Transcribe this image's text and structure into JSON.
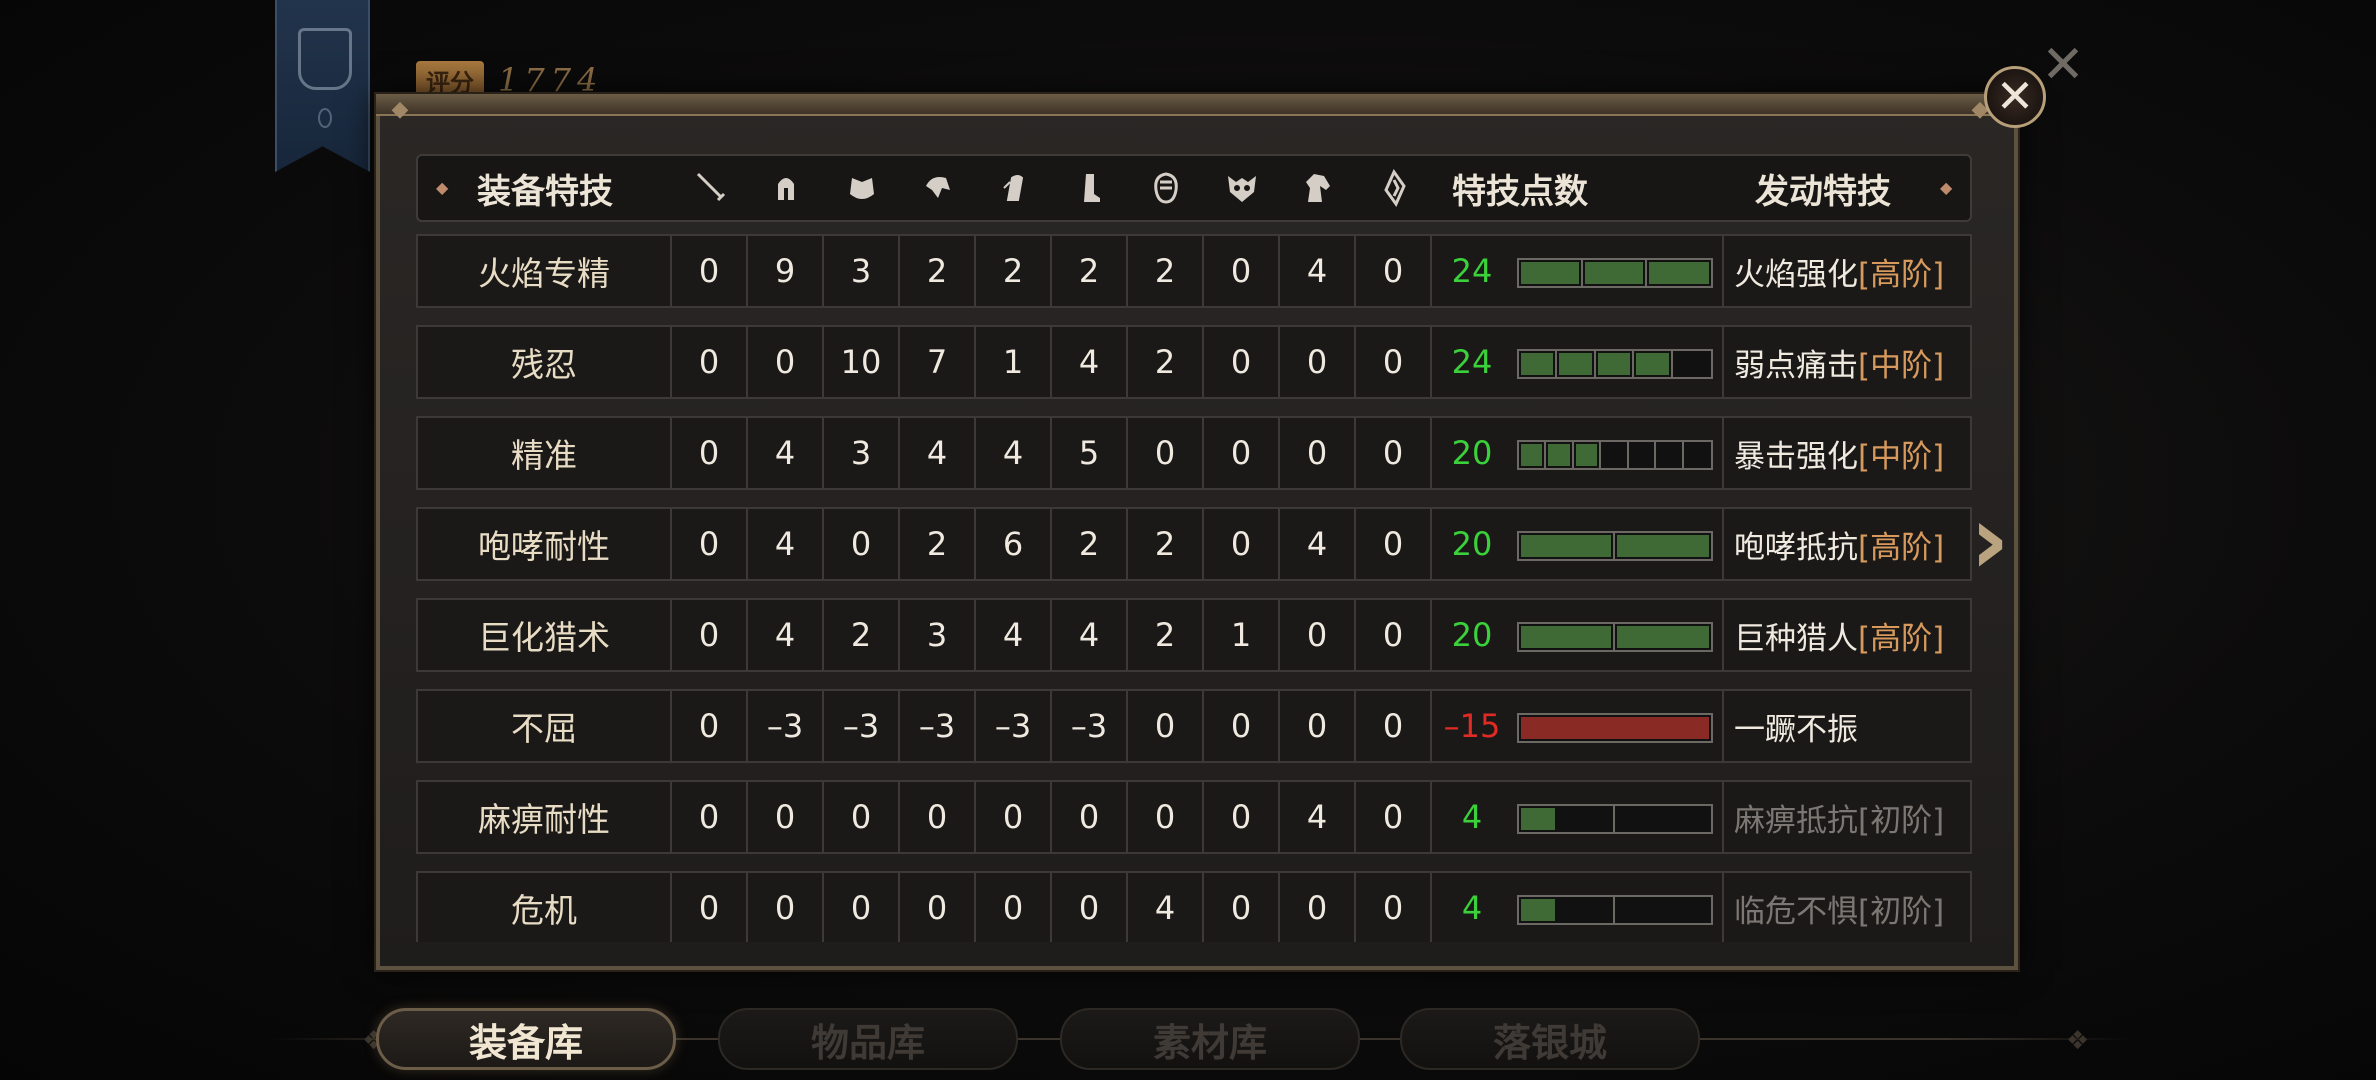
{
  "background": {
    "score_label": "评分",
    "score_value": "1774"
  },
  "header": {
    "title": "装备特技",
    "slot_icons": [
      "sword-icon",
      "helmet-icon",
      "chest-armor-icon",
      "arm-armor-icon",
      "waist-armor-icon",
      "leg-armor-icon",
      "charm-icon",
      "monster-mask-icon",
      "pet-icon",
      "wing-icon"
    ],
    "points_label": "特技点数",
    "active_label": "发动特技"
  },
  "colors": {
    "positive": "#3ad13a",
    "negative": "#e02a24",
    "tier": "#d79a5c",
    "bar_fill": "#3f6a36",
    "bar_negative": "#8a2a24"
  },
  "rows": [
    {
      "name": "火焰专精",
      "values": [
        "0",
        "9",
        "3",
        "2",
        "2",
        "2",
        "2",
        "0",
        "4",
        "0"
      ],
      "points": "24",
      "segments": 3,
      "fill_ratio": 1.0,
      "skill": "火焰强化",
      "tier": "[高阶]",
      "dim": false,
      "negative": false
    },
    {
      "name": "残忍",
      "values": [
        "0",
        "0",
        "10",
        "7",
        "1",
        "4",
        "2",
        "0",
        "0",
        "0"
      ],
      "points": "24",
      "segments": 5,
      "fill_ratio": 0.8,
      "skill": "弱点痛击",
      "tier": "[中阶]",
      "dim": false,
      "negative": false
    },
    {
      "name": "精准",
      "values": [
        "0",
        "4",
        "3",
        "4",
        "4",
        "5",
        "0",
        "0",
        "0",
        "0"
      ],
      "points": "20",
      "segments": 7,
      "fill_ratio": 0.4286,
      "skill": "暴击强化",
      "tier": "[中阶]",
      "dim": false,
      "negative": false
    },
    {
      "name": "咆哮耐性",
      "values": [
        "0",
        "4",
        "0",
        "2",
        "6",
        "2",
        "2",
        "0",
        "4",
        "0"
      ],
      "points": "20",
      "segments": 2,
      "fill_ratio": 1.0,
      "skill": "咆哮抵抗",
      "tier": "[高阶]",
      "dim": false,
      "negative": false
    },
    {
      "name": "巨化猎术",
      "values": [
        "0",
        "4",
        "2",
        "3",
        "4",
        "4",
        "2",
        "1",
        "0",
        "0"
      ],
      "points": "20",
      "segments": 2,
      "fill_ratio": 1.0,
      "skill": "巨种猎人",
      "tier": "[高阶]",
      "dim": false,
      "negative": false
    },
    {
      "name": "不屈",
      "values": [
        "0",
        "–3",
        "–3",
        "–3",
        "–3",
        "–3",
        "0",
        "0",
        "0",
        "0"
      ],
      "points": "–15",
      "segments": 1,
      "fill_ratio": 1.0,
      "skill": "一蹶不振",
      "tier": "",
      "dim": false,
      "negative": true
    },
    {
      "name": "麻痹耐性",
      "values": [
        "0",
        "0",
        "0",
        "0",
        "0",
        "0",
        "0",
        "0",
        "4",
        "0"
      ],
      "points": "4",
      "segments": 2,
      "fill_ratio": 0.2,
      "skill": "麻痹抵抗",
      "tier": "[初阶]",
      "dim": true,
      "negative": false
    },
    {
      "name": "危机",
      "values": [
        "0",
        "0",
        "0",
        "0",
        "0",
        "0",
        "4",
        "0",
        "0",
        "0"
      ],
      "points": "4",
      "segments": 2,
      "fill_ratio": 0.2,
      "skill": "临危不惧",
      "tier": "[初阶]",
      "dim": true,
      "negative": false
    }
  ],
  "tabs": [
    {
      "label": "装备库",
      "active": true
    },
    {
      "label": "物品库",
      "active": false
    },
    {
      "label": "素材库",
      "active": false
    },
    {
      "label": "落银城",
      "active": false
    }
  ]
}
